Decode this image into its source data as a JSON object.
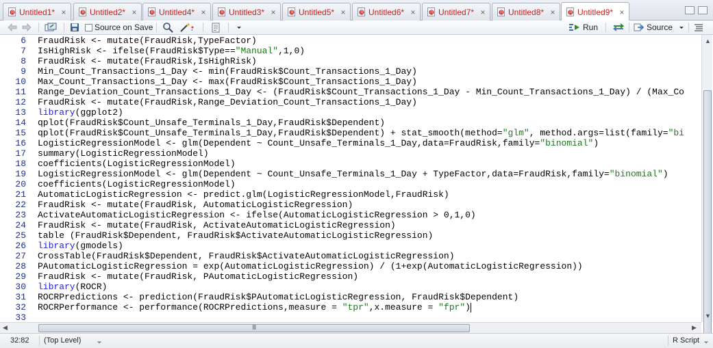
{
  "tabs": [
    {
      "label": "Untitled1*"
    },
    {
      "label": "Untitled2*"
    },
    {
      "label": "Untitled4*"
    },
    {
      "label": "Untitled3*"
    },
    {
      "label": "Untitled5*"
    },
    {
      "label": "Untitled6*"
    },
    {
      "label": "Untitled7*"
    },
    {
      "label": "Untitled8*"
    },
    {
      "label": "Untitled9*"
    }
  ],
  "tab_close_glyph": "×",
  "toolbar": {
    "source_on_save_label": "Source on Save",
    "run_label": "Run",
    "source_label": "Source"
  },
  "editor": {
    "lines": [
      {
        "n": "6",
        "tokens": [
          [
            "t",
            "FraudRisk <- mutate(FraudRisk,TypeFactor)"
          ]
        ]
      },
      {
        "n": "7",
        "tokens": [
          [
            "t",
            "IsHighRisk <- ifelse(FraudRisk$Type=="
          ],
          [
            "s",
            "\"Manual\""
          ],
          [
            "t",
            ",1,0)"
          ]
        ]
      },
      {
        "n": "8",
        "tokens": [
          [
            "t",
            "FraudRisk <- mutate(FraudRisk,IsHighRisk)"
          ]
        ]
      },
      {
        "n": "9",
        "tokens": [
          [
            "t",
            "Min_Count_Transactions_1_Day <- min(FraudRisk$Count_Transactions_1_Day)"
          ]
        ]
      },
      {
        "n": "10",
        "tokens": [
          [
            "t",
            "Max_Count_Transactions_1_Day <- max(FraudRisk$Count_Transactions_1_Day)"
          ]
        ]
      },
      {
        "n": "11",
        "tokens": [
          [
            "t",
            "Range_Deviation_Count_Transactions_1_Day <- (FraudRisk$Count_Transactions_1_Day - Min_Count_Transactions_1_Day) / (Max_Co"
          ]
        ]
      },
      {
        "n": "12",
        "tokens": [
          [
            "t",
            "FraudRisk <- mutate(FraudRisk,Range_Deviation_Count_Transactions_1_Day)"
          ]
        ]
      },
      {
        "n": "13",
        "tokens": [
          [
            "k",
            "library"
          ],
          [
            "t",
            "(ggplot2)"
          ]
        ]
      },
      {
        "n": "14",
        "tokens": [
          [
            "t",
            "qplot(FraudRisk$Count_Unsafe_Terminals_1_Day,FraudRisk$Dependent)"
          ]
        ]
      },
      {
        "n": "15",
        "tokens": [
          [
            "t",
            "qplot(FraudRisk$Count_Unsafe_Terminals_1_Day,FraudRisk$Dependent) + stat_smooth(method="
          ],
          [
            "s",
            "\"glm\""
          ],
          [
            "t",
            ", method.args=list(family="
          ],
          [
            "s",
            "\"bi"
          ]
        ]
      },
      {
        "n": "16",
        "tokens": [
          [
            "t",
            "LogisticRegressionModel <- glm(Dependent ~ Count_Unsafe_Terminals_1_Day,data=FraudRisk,family="
          ],
          [
            "s",
            "\"binomial\""
          ],
          [
            "t",
            ")"
          ]
        ]
      },
      {
        "n": "17",
        "tokens": [
          [
            "t",
            "summary(LogisticRegressionModel)"
          ]
        ]
      },
      {
        "n": "18",
        "tokens": [
          [
            "t",
            "coefficients(LogisticRegressionModel)"
          ]
        ]
      },
      {
        "n": "19",
        "tokens": [
          [
            "t",
            "LogisticRegressionModel <- glm(Dependent ~ Count_Unsafe_Terminals_1_Day + TypeFactor,data=FraudRisk,family="
          ],
          [
            "s",
            "\"binomial\""
          ],
          [
            "t",
            ")"
          ]
        ]
      },
      {
        "n": "20",
        "tokens": [
          [
            "t",
            "coefficients(LogisticRegressionModel)"
          ]
        ]
      },
      {
        "n": "21",
        "tokens": [
          [
            "t",
            "AutomaticLogisticRegression <- predict.glm(LogisticRegressionModel,FraudRisk)"
          ]
        ]
      },
      {
        "n": "22",
        "tokens": [
          [
            "t",
            "FraudRisk <- mutate(FraudRisk, AutomaticLogisticRegression)"
          ]
        ]
      },
      {
        "n": "23",
        "tokens": [
          [
            "t",
            "ActivateAutomaticLogisticRegression <- ifelse(AutomaticLogisticRegression > 0,1,0)"
          ]
        ]
      },
      {
        "n": "24",
        "tokens": [
          [
            "t",
            "FraudRisk <- mutate(FraudRisk, ActivateAutomaticLogisticRegression)"
          ]
        ]
      },
      {
        "n": "25",
        "tokens": [
          [
            "t",
            "table (FraudRisk$Dependent, FraudRisk$ActivateAutomaticLogisticRegression)"
          ]
        ]
      },
      {
        "n": "26",
        "tokens": [
          [
            "k",
            "library"
          ],
          [
            "t",
            "(gmodels)"
          ]
        ]
      },
      {
        "n": "27",
        "tokens": [
          [
            "t",
            "CrossTable(FraudRisk$Dependent, FraudRisk$ActivateAutomaticLogisticRegression)"
          ]
        ]
      },
      {
        "n": "28",
        "tokens": [
          [
            "t",
            "PAutomaticLogisticRegression = exp(AutomaticLogisticRegression) / (1+exp(AutomaticLogisticRegression))"
          ]
        ]
      },
      {
        "n": "29",
        "tokens": [
          [
            "t",
            "FraudRisk <- mutate(FraudRisk, PAutomaticLogisticRegression)"
          ]
        ]
      },
      {
        "n": "30",
        "tokens": [
          [
            "k",
            "library"
          ],
          [
            "t",
            "(ROCR)"
          ]
        ]
      },
      {
        "n": "31",
        "tokens": [
          [
            "t",
            "ROCRPredictions <- prediction(FraudRisk$PAutomaticLogisticRegression, FraudRisk$Dependent)"
          ]
        ]
      },
      {
        "n": "32",
        "tokens": [
          [
            "t",
            "ROCRPerformance <- performance(ROCRPredictions,measure = "
          ],
          [
            "s",
            "\"tpr\""
          ],
          [
            "t",
            ",x.measure = "
          ],
          [
            "s",
            "\"fpr\""
          ],
          [
            "t",
            ")"
          ],
          [
            "c",
            ""
          ]
        ]
      },
      {
        "n": "33",
        "tokens": []
      }
    ]
  },
  "status": {
    "cursor_position": "32:82",
    "scope": "(Top Level)",
    "file_type": "R Script"
  }
}
